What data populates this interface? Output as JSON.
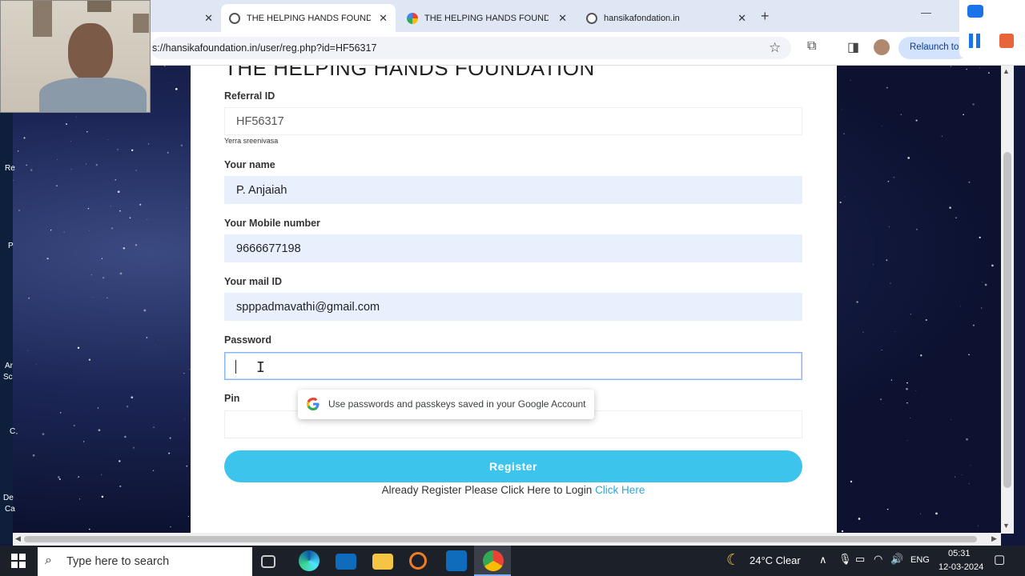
{
  "browser": {
    "tabs": [
      {
        "title": "",
        "active": false
      },
      {
        "title": "THE HELPING HANDS FOUNDA",
        "active": true
      },
      {
        "title": "THE HELPING HANDS FOUNDA",
        "active": false
      },
      {
        "title": "hansikafondation.in",
        "active": false
      }
    ],
    "new_tab": "+",
    "minimize": "—",
    "url": "s://hansikafoundation.in/user/reg.php?id=HF56317",
    "relaunch": "Relaunch to"
  },
  "form": {
    "title": "THE HELPING HANDS FOUNDATION",
    "referral_label": "Referral ID",
    "referral_value": "HF56317",
    "referral_name": "Yerra sreenivasa",
    "name_label": "Your name",
    "name_value": "P. Anjaiah",
    "mobile_label": "Your Mobile number",
    "mobile_value": "9666677198",
    "mail_label": "Your mail ID",
    "mail_value": "spppadmavathi@gmail.com",
    "password_label": "Password",
    "password_value": "",
    "pin_label": "Pin",
    "pin_value": "",
    "password_suggestion": "Use passwords and passkeys saved in your Google Account",
    "register_label": "Register",
    "login_text": "Already Register Please Click Here to Login",
    "login_link": "Click Here"
  },
  "desktop_labels": [
    "Re",
    "P",
    "Ar",
    "Sc",
    "C",
    "De",
    "Ca"
  ],
  "taskbar": {
    "search_placeholder": "Type here to search",
    "weather": "24°C  Clear",
    "language": "ENG",
    "time": "05:31",
    "date": "12-03-2024"
  },
  "colors": {
    "register_button": "#3dc4ec",
    "autofill_bg": "#e8f0fe",
    "link": "#2aa6d8",
    "tab_strip": "#dfe7f5"
  },
  "icons": [
    "close-icon",
    "globe-icon",
    "google-icon",
    "star-icon",
    "extensions-icon",
    "sidepanel-icon",
    "profile-icon",
    "pause-icon",
    "stop-icon",
    "windows-icon",
    "search-icon",
    "taskview-icon",
    "edge-icon",
    "mail-icon",
    "explorer-icon",
    "store-icon",
    "chrome-icon",
    "moon-icon",
    "notification-icon"
  ]
}
